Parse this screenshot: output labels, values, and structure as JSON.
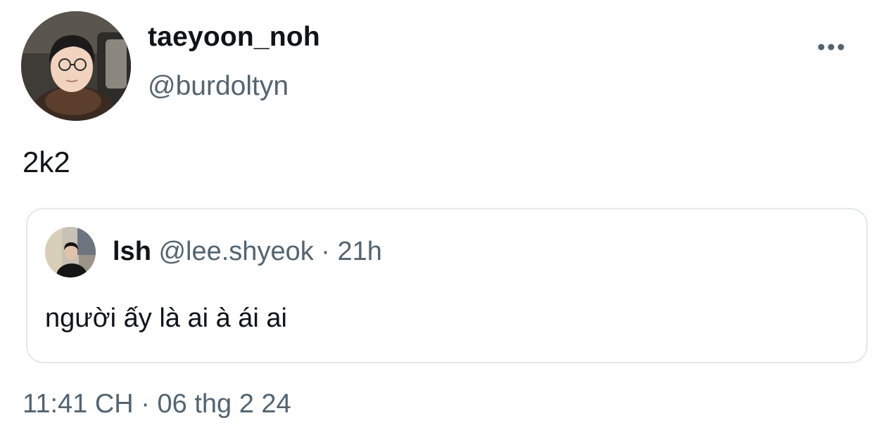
{
  "post": {
    "author": {
      "display_name": "taeyoon_noh",
      "handle": "@burdoltyn",
      "avatar": "profile-photo"
    },
    "more_icon": "more-horizontal-icon",
    "text": "2k2",
    "quote": {
      "author": {
        "display_name": "lsh",
        "handle": "@lee.shyeok",
        "avatar": "profile-photo"
      },
      "separator": "·",
      "time": "21h",
      "text": "người ấy là ai à ái ai"
    },
    "timestamp": {
      "time": "11:41 CH",
      "separator": "·",
      "date": "06 thg 2 24"
    }
  },
  "colors": {
    "text_primary": "#0f1419",
    "text_secondary": "#536471",
    "border": "#e4e8eb",
    "background": "#ffffff"
  }
}
